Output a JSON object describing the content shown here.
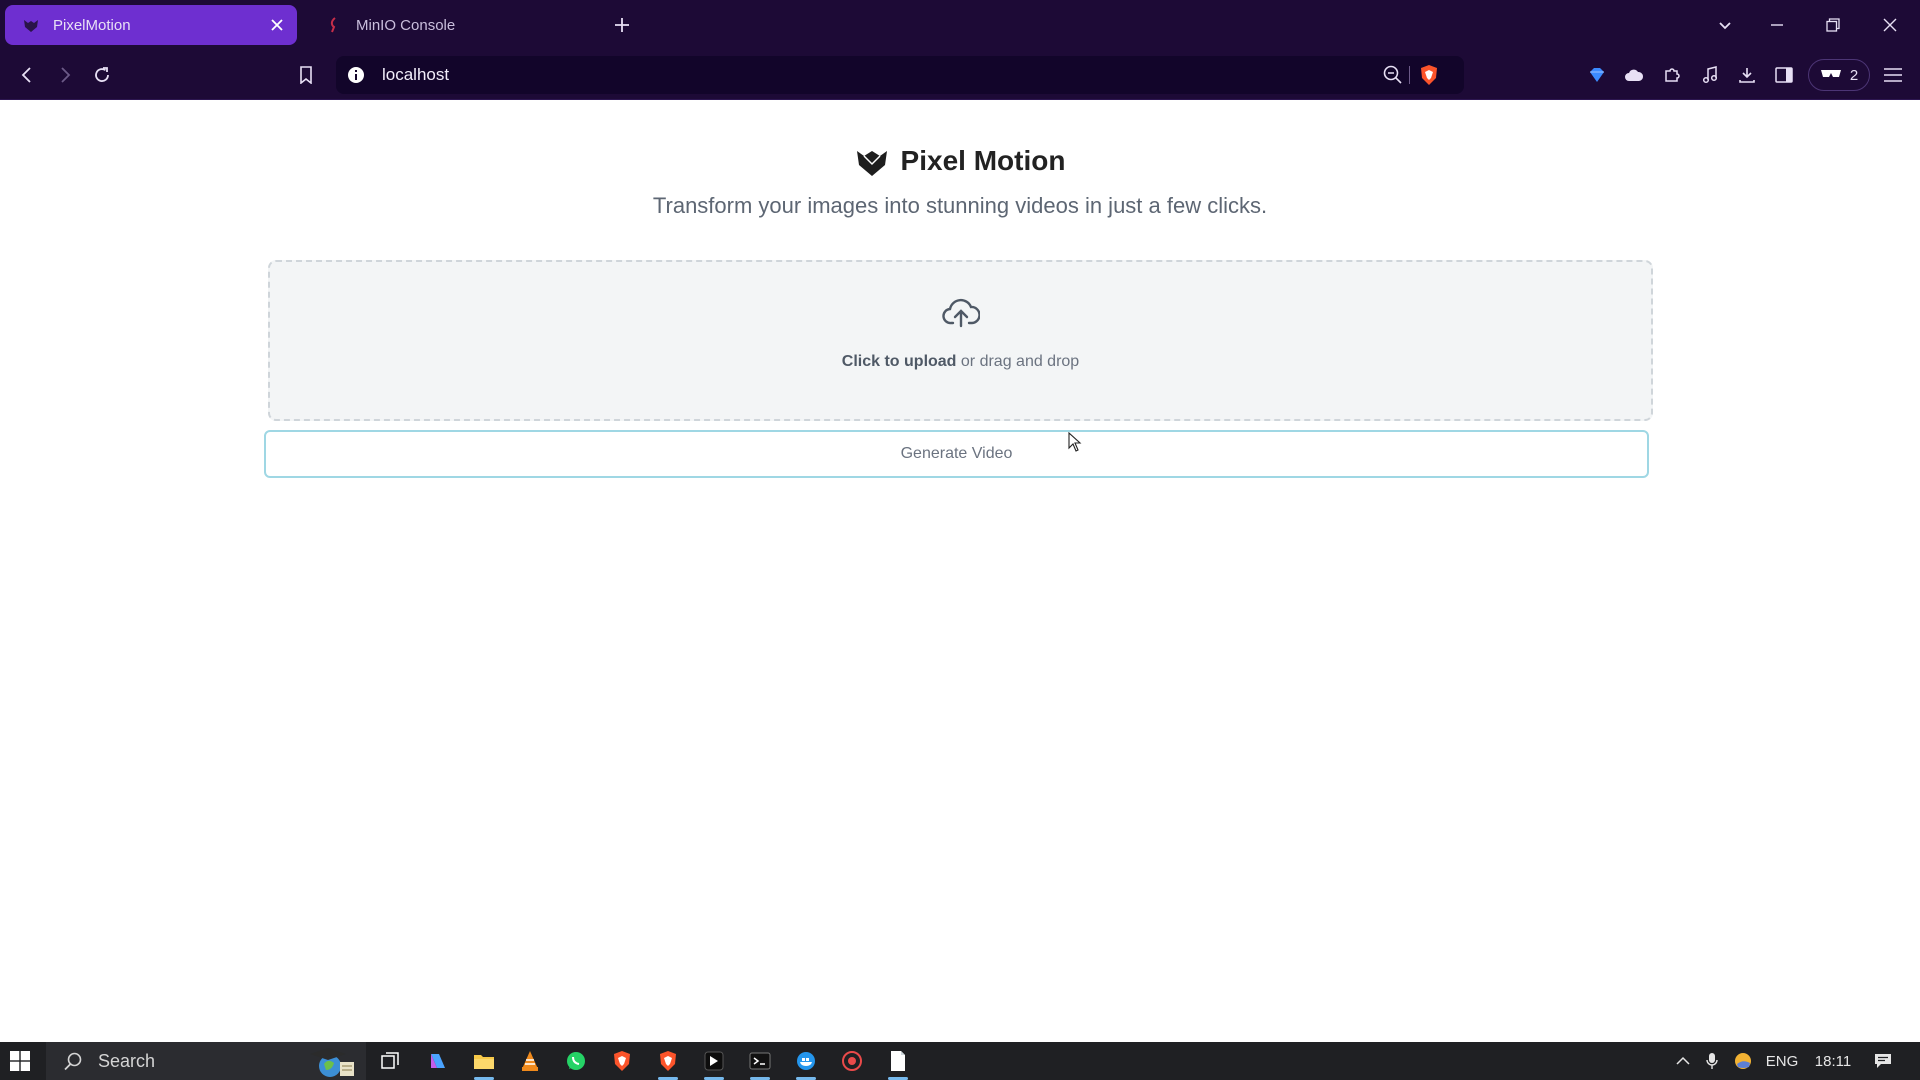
{
  "browser": {
    "tabs": [
      {
        "label": "PixelMotion",
        "active": true
      },
      {
        "label": "MinIO Console",
        "active": false
      }
    ],
    "url": "localhost",
    "wallet_count": "2"
  },
  "app": {
    "title": "Pixel Motion",
    "subtitle": "Transform your images into stunning videos in just a few clicks.",
    "upload": {
      "action": "Click to upload",
      "hint": " or drag and drop"
    },
    "generate_label": "Generate Video"
  },
  "taskbar": {
    "search_label": "Search",
    "language": "ENG",
    "time": "18:11"
  },
  "colors": {
    "chrome_bg": "#1d0a36",
    "active_tab": "#6e2fd0",
    "dropzone_bg": "#f3f5f6",
    "button_border": "#9fd7e4",
    "taskbar_bg": "#1f2023"
  }
}
